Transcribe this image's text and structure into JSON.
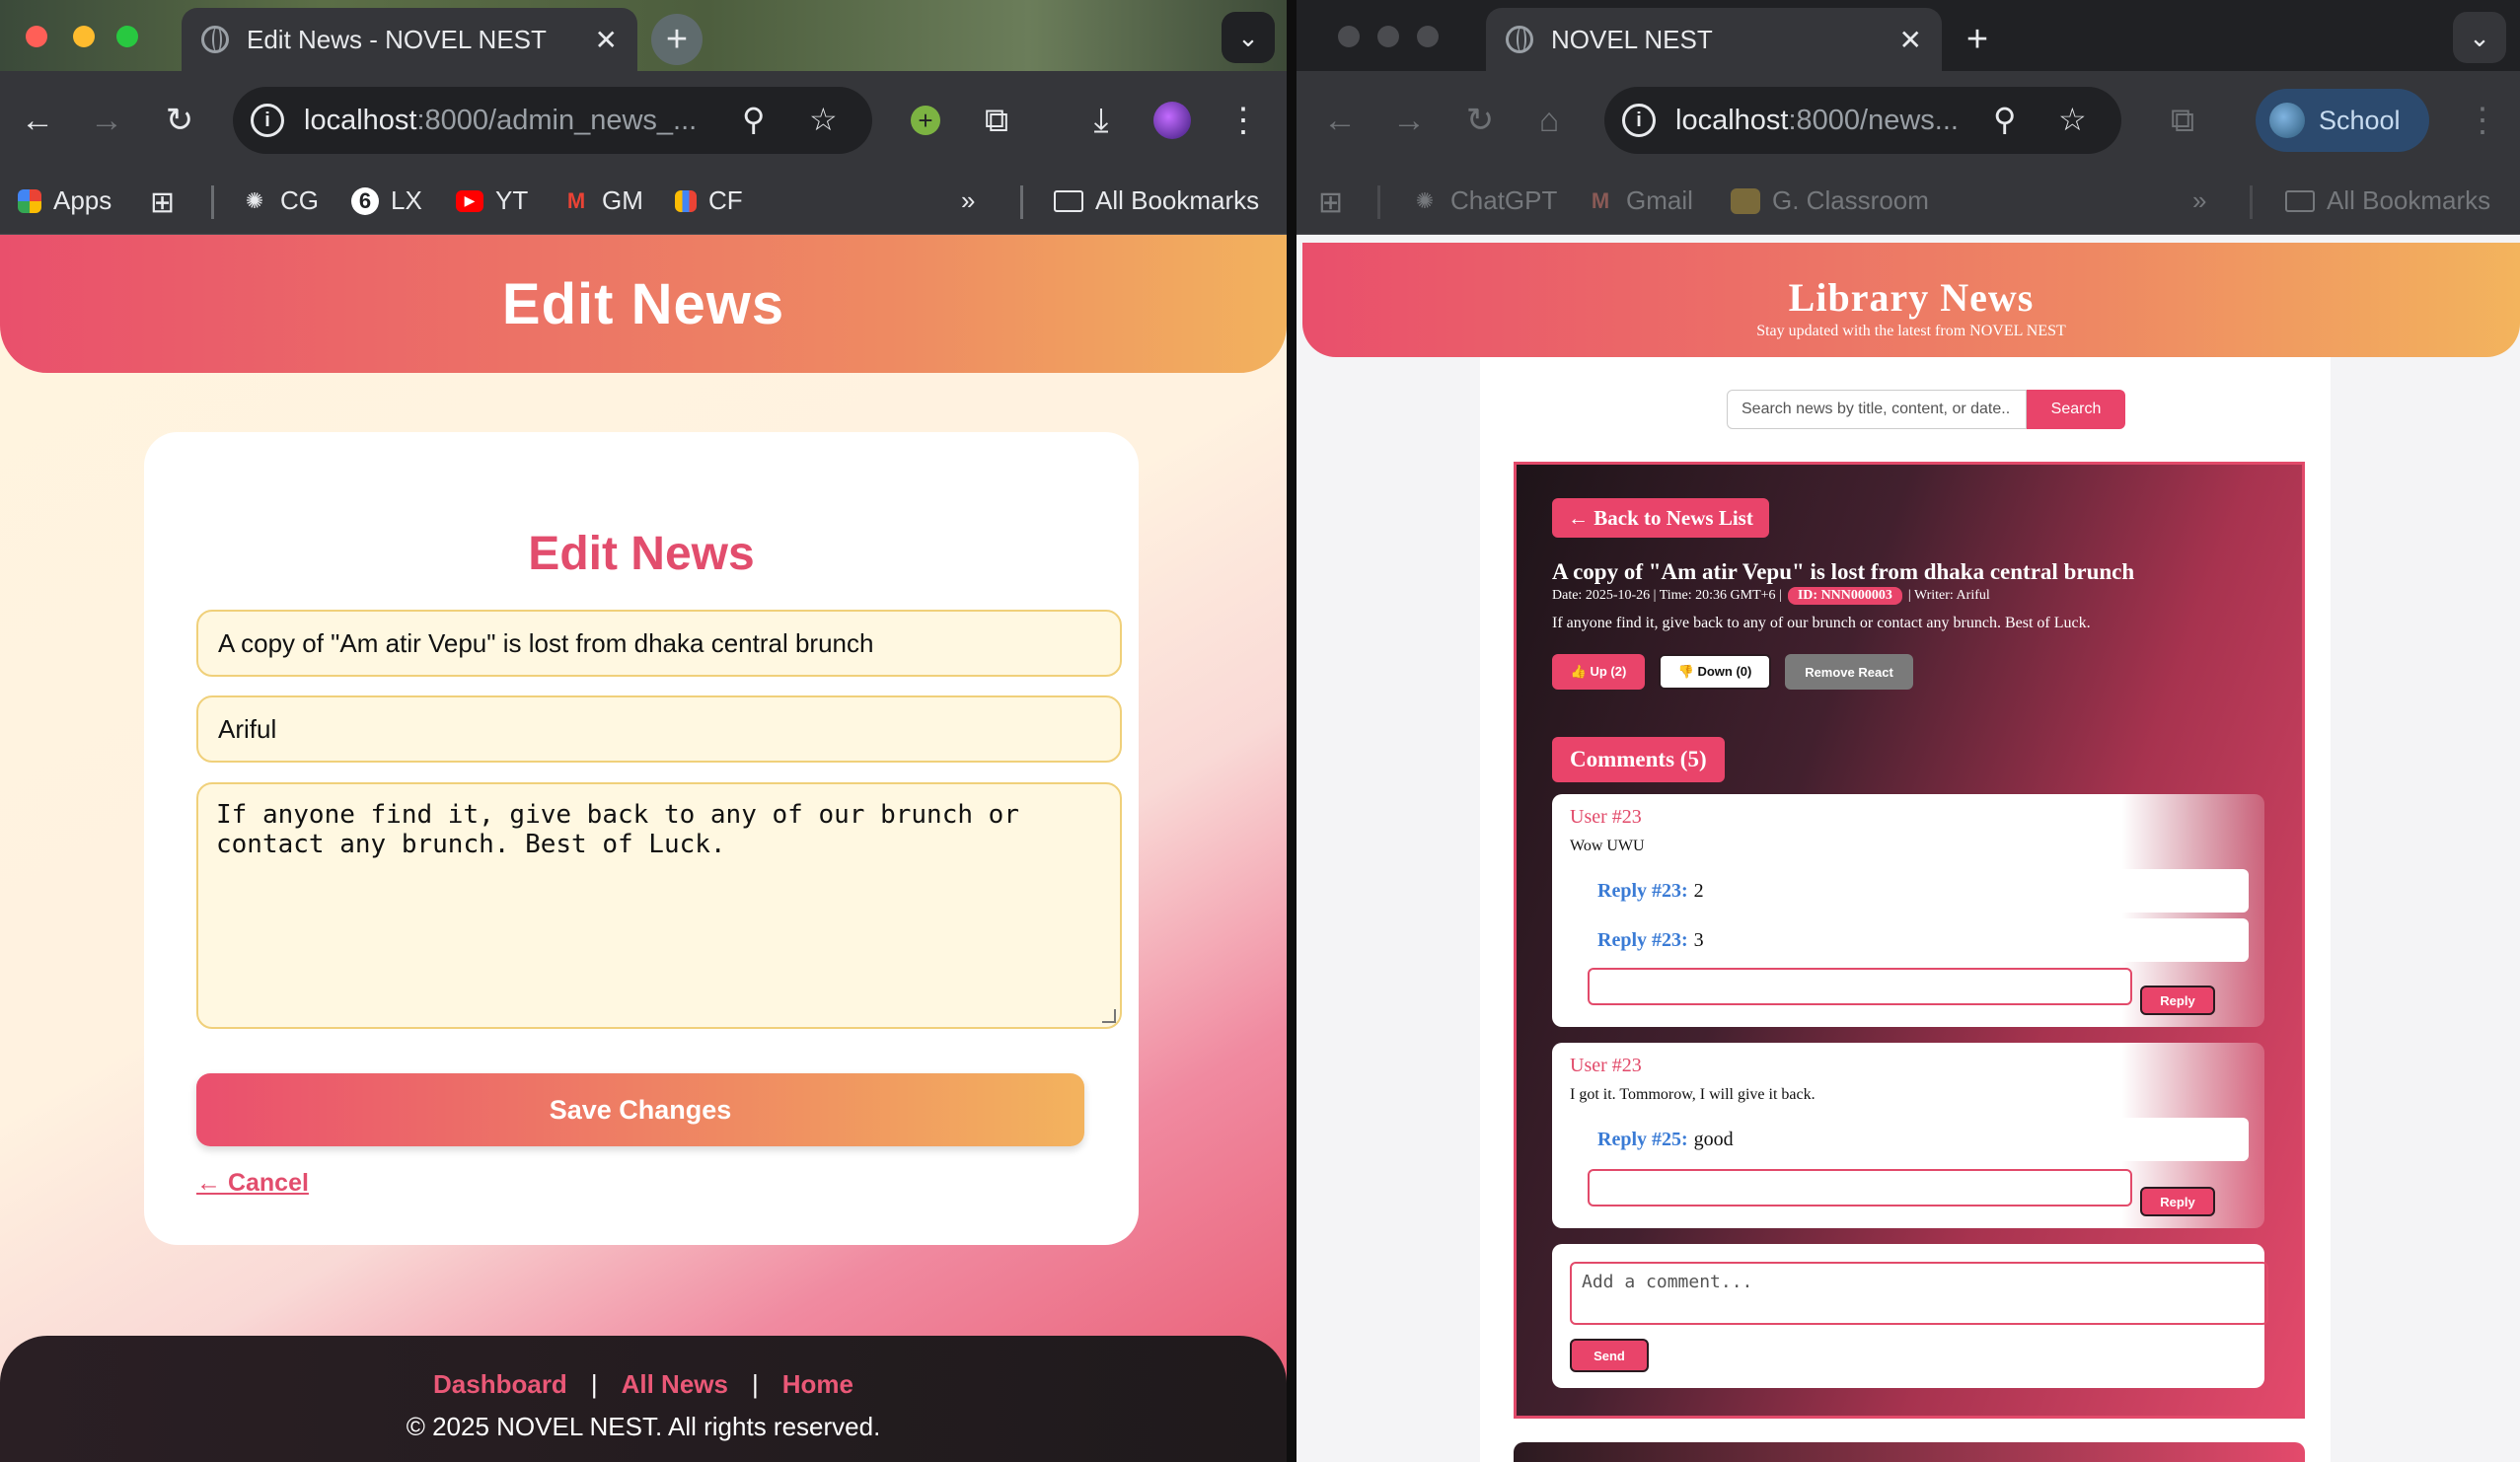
{
  "left_window": {
    "tab_title": "Edit News - NOVEL NEST",
    "url_host": "localhost",
    "url_rest": ":8000/admin_news_...",
    "bookmarks": [
      {
        "label": "Apps",
        "icon": "apps-grid-icon"
      },
      {
        "label": "CG",
        "icon": "chatgpt-icon"
      },
      {
        "label": "LX",
        "icon": "lx-icon"
      },
      {
        "label": "YT",
        "icon": "youtube-icon"
      },
      {
        "label": "GM",
        "icon": "gmail-icon"
      },
      {
        "label": "CF",
        "icon": "chart-icon"
      }
    ],
    "all_bookmarks": "All Bookmarks",
    "page": {
      "header_title": "Edit News",
      "form_title": "Edit News",
      "title_value": "A copy of \"Am atir Vepu\" is lost from dhaka central brunch",
      "writer_value": "Ariful",
      "content_value": "If anyone find it, give back to any of our brunch or\ncontact any brunch. Best of Luck.",
      "save_label": "Save Changes",
      "cancel_label": "← Cancel",
      "footer_links": [
        "Dashboard",
        "All News",
        "Home"
      ],
      "footer_sep": "|",
      "copyright": "© 2025 NOVEL NEST. All rights reserved."
    }
  },
  "right_window": {
    "tab_title": "NOVEL NEST",
    "url_host": "localhost",
    "url_rest": ":8000/news...",
    "profile_label": "School",
    "bookmarks": [
      {
        "label": "ChatGPT",
        "icon": "chatgpt-icon"
      },
      {
        "label": "Gmail",
        "icon": "gmail-icon"
      },
      {
        "label": "G. Classroom",
        "icon": "classroom-icon"
      }
    ],
    "all_bookmarks": "All Bookmarks",
    "page": {
      "header_title": "Library News",
      "header_subtitle": "Stay updated with the latest from NOVEL NEST",
      "search_placeholder": "Search news by title, content, or date..",
      "search_button": "Search",
      "back_button": "← Back to News List",
      "news_title": "A copy of \"Am atir Vepu\" is lost from dhaka central brunch",
      "meta_date": "Date: 2025-10-26 | Time: 20:36 GMT+6 |",
      "meta_id": "ID: NNN000003",
      "meta_writer": "| Writer: Ariful",
      "news_body": "If anyone find it, give back to any of our brunch or contact any brunch. Best of Luck.",
      "react_up": "👍 Up (2)",
      "react_down": "👎 Down (0)",
      "react_remove": "Remove React",
      "comments_heading": "Comments (5)",
      "comments": [
        {
          "user": "User #23",
          "text": "Wow UWU",
          "replies": [
            {
              "by": "Reply #23:",
              "text": "2"
            },
            {
              "by": "Reply #23:",
              "text": "3"
            }
          ],
          "reply_button": "Reply"
        },
        {
          "user": "User #23",
          "text": "I got it. Tommorow, I will give it back.",
          "replies": [
            {
              "by": "Reply #25:",
              "text": "good"
            }
          ],
          "reply_button": "Reply"
        }
      ],
      "add_comment_placeholder": "Add a comment...",
      "send_button": "Send"
    }
  },
  "colors": {
    "accent": "#e9446a",
    "gradient_end": "#f3b45d",
    "reply_blue": "#3a7bd5"
  }
}
